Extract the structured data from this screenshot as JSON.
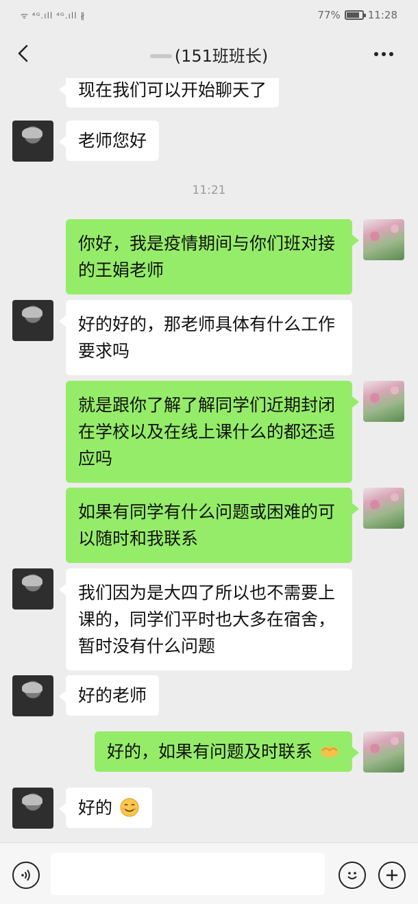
{
  "status_bar": {
    "left_signal": "ᯤ ⁴ᴳ.ıll ⁴ᴳ.ıll ∦",
    "battery": "77%",
    "time": "11:28"
  },
  "header": {
    "title": "(151班班长)"
  },
  "messages": [
    {
      "side": "left",
      "text": "现在我们可以开始聊天了"
    },
    {
      "side": "left",
      "text": "老师您好"
    },
    {
      "type": "timestamp",
      "text": "11:21"
    },
    {
      "side": "right",
      "text": "你好，我是疫情期间与你们班对接的王娟老师"
    },
    {
      "side": "left",
      "text": "好的好的，那老师具体有什么工作要求吗"
    },
    {
      "side": "right",
      "text": "就是跟你了解了解同学们近期封闭在学校以及在线上课什么的都还适应吗"
    },
    {
      "side": "right",
      "text": "如果有同学有什么问题或困难的可以随时和我联系"
    },
    {
      "side": "left",
      "text": "我们因为是大四了所以也不需要上课的，同学们平时也大多在宿舍，暂时没有什么问题"
    },
    {
      "side": "left",
      "text": "好的老师"
    },
    {
      "side": "right",
      "text": "好的，如果有问题及时联系",
      "emoji": "handshake-emoji"
    },
    {
      "side": "left",
      "text": "好的",
      "emoji": "smile-emoji"
    }
  ],
  "icons": {
    "back": "chevron-left-icon",
    "more": "more-dots-icon",
    "voice": "voice-icon",
    "emoji": "emoji-icon",
    "plus": "plus-icon"
  },
  "colors": {
    "background": "#ededed",
    "bubble_self": "#95ec69",
    "bubble_other": "#ffffff",
    "timestamp": "#9a9a9a"
  }
}
